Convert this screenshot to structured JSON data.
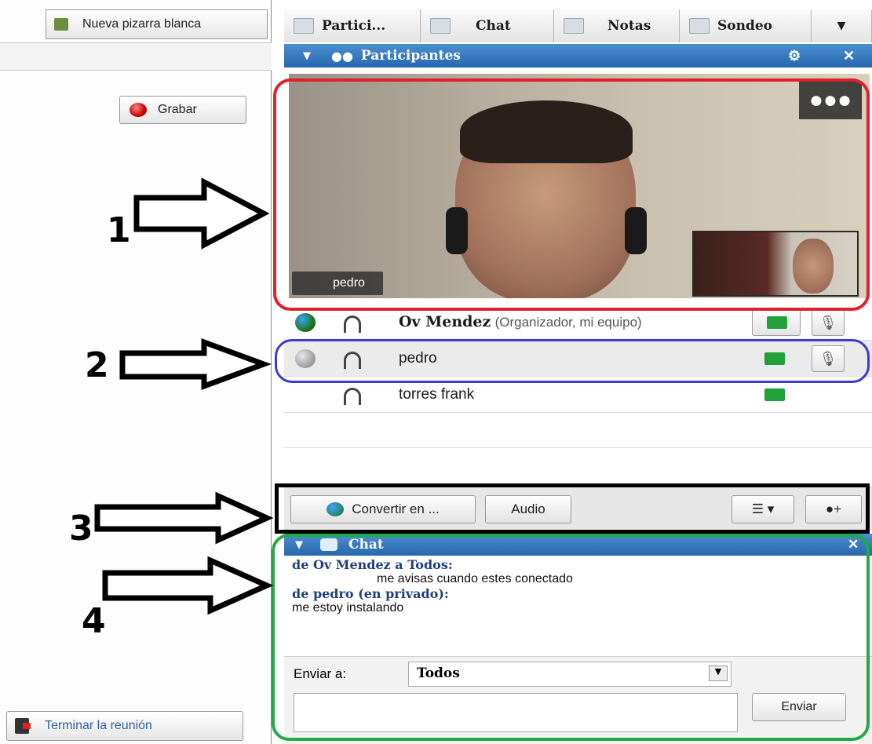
{
  "left_panel": {
    "whiteboard_button": "Nueva pizarra blanca",
    "record_button": "Grabar",
    "end_meeting_button": "Terminar la reunión"
  },
  "tabs": [
    {
      "label": "Partici..."
    },
    {
      "label": "Chat"
    },
    {
      "label": "Notas"
    },
    {
      "label": "Sondeo"
    }
  ],
  "participants_panel": {
    "title": "Participantes",
    "video_label": "pedro",
    "rows": [
      {
        "name": "Ov Mendez",
        "role": "(Organizador, mi equipo)",
        "status_color": "#2a9d2a"
      },
      {
        "name": "pedro",
        "role": "",
        "status_color": "#b8b8b8"
      },
      {
        "name": "torres frank",
        "role": "",
        "status_color": ""
      }
    ],
    "convert_button": "Convertir en ...",
    "audio_button": "Audio"
  },
  "chat_panel": {
    "title": "Chat",
    "messages": [
      {
        "from": "de Ov Mendez a Todos:",
        "text": "me avisas cuando estes conectado"
      },
      {
        "from": "de pedro (en privado):",
        "text": "me estoy instalando"
      }
    ],
    "send_to_label": "Enviar a:",
    "send_to_value": "Todos",
    "send_button": "Enviar"
  },
  "annotations": [
    "1",
    "2",
    "3",
    "4"
  ],
  "colors": {
    "ring1": "#e0202a",
    "ring2": "#3a3ad0",
    "ring3": "#000000",
    "ring4": "#22aa44",
    "panel_blue": "#2f72b8"
  }
}
